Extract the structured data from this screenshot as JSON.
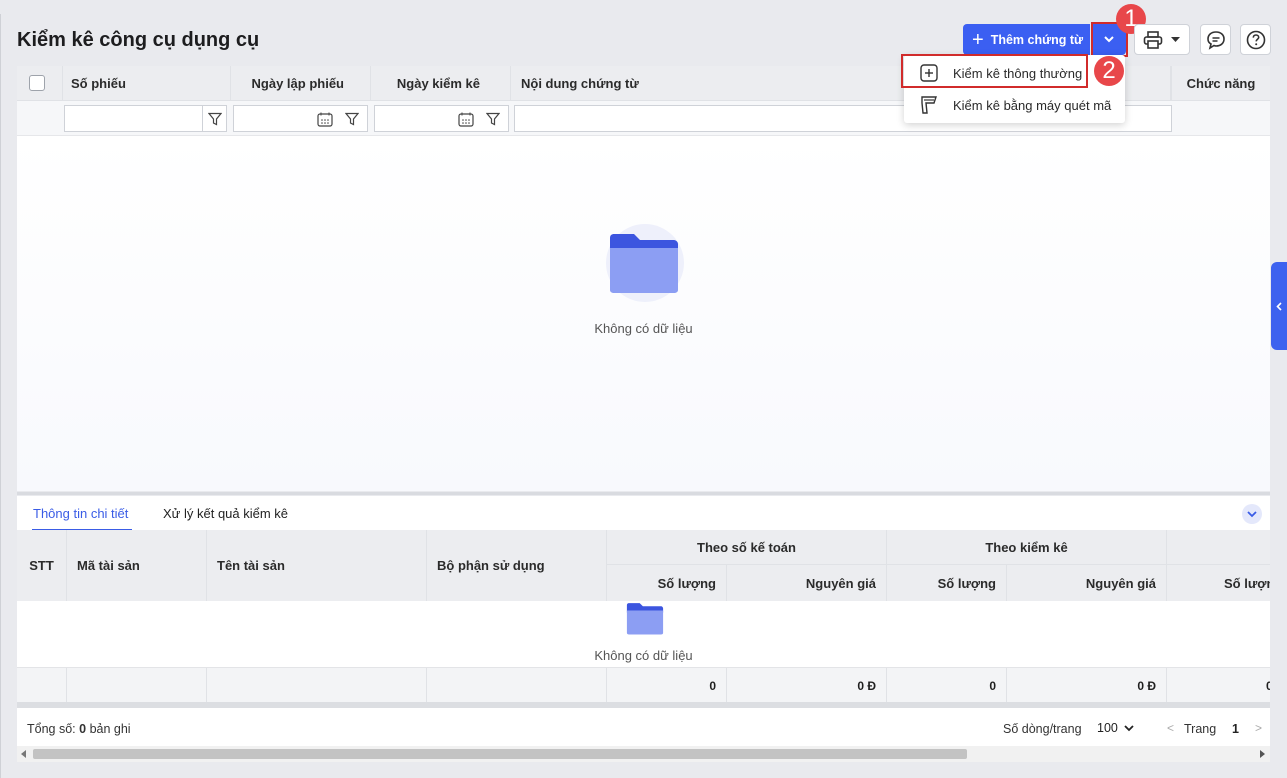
{
  "page": {
    "title": "Kiểm kê công cụ dụng cụ"
  },
  "toolbar": {
    "add_label": "Thêm chứng từ"
  },
  "annotations": {
    "badge1": "1",
    "badge2": "2"
  },
  "dropdown": {
    "items": [
      {
        "label": "Kiểm kê thông thường",
        "icon": "plus-square-icon"
      },
      {
        "label": "Kiểm kê bằng máy quét mã",
        "icon": "barcode-scanner-icon"
      }
    ]
  },
  "grid": {
    "columns": [
      "Số phiếu",
      "Ngày lập phiếu",
      "Ngày kiểm kê",
      "Nội dung chứng từ",
      "Chức năng"
    ],
    "empty_text": "Không có dữ liệu"
  },
  "detail": {
    "tabs": [
      "Thông tin chi tiết",
      "Xử lý kết quả kiểm kê"
    ],
    "columns": {
      "stt": "STT",
      "ma": "Mã tài sản",
      "ten": "Tên tài sản",
      "bophan": "Bộ phận sử dụng",
      "group1": "Theo số kế toán",
      "group2": "Theo kiểm kê",
      "soluong": "Số lượng",
      "nguyengia": "Nguyên giá",
      "soluong_clip": "Số lượng"
    },
    "empty_text": "Không có dữ liệu",
    "totals": [
      "0",
      "0 Đ",
      "0",
      "0 Đ",
      "0"
    ]
  },
  "pager": {
    "total_prefix": "Tổng số:",
    "total_count": "0",
    "total_suffix": "bản ghi",
    "rows_label": "Số dòng/trang",
    "rows_value": "100",
    "page_label": "Trang",
    "page_value": "1"
  },
  "colors": {
    "accent": "#3b5ff2",
    "highlight": "#d12b2b",
    "badge": "#e8474a"
  }
}
